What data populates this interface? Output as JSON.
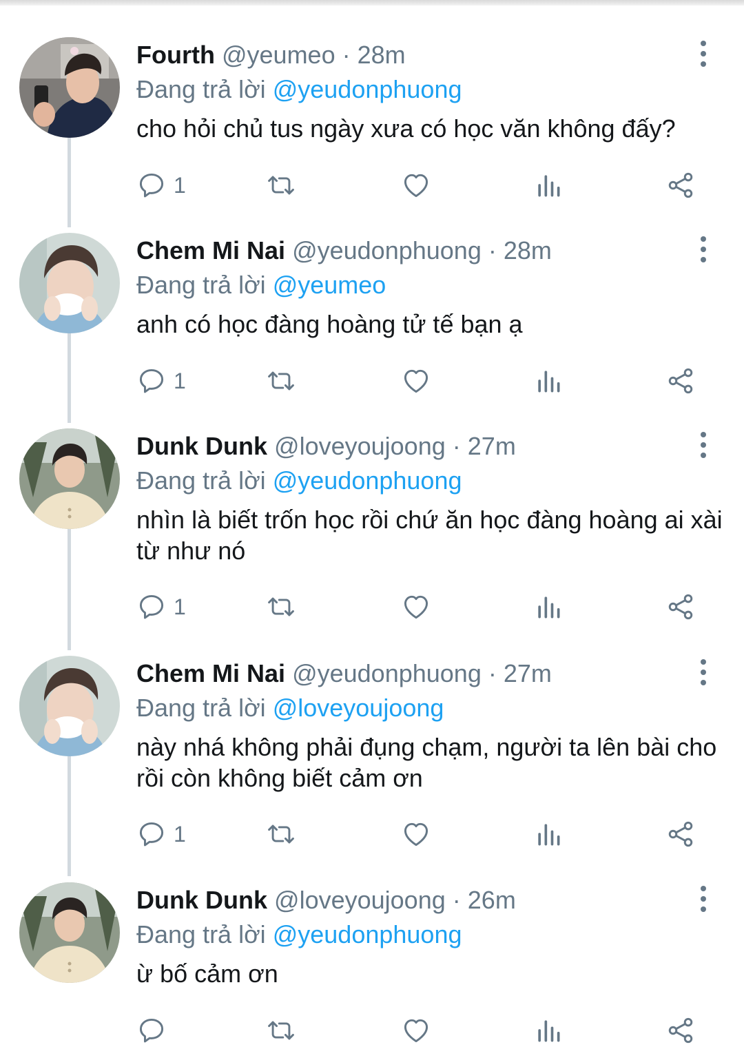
{
  "replying_label": "Đang trả lời",
  "separator": "·",
  "colors": {
    "accent": "#1da1f2",
    "muted": "#657786",
    "text": "#14171a",
    "thread_line": "#d2d9df"
  },
  "icons": {
    "reply": "reply-bubble-icon",
    "retweet": "retweet-icon",
    "like": "heart-icon",
    "analytics": "bar-chart-icon",
    "share": "share-icon",
    "more": "vertical-dots-icon"
  },
  "tweets": [
    {
      "name": "Fourth",
      "handle": "@yeumeo",
      "time": "28m",
      "replying_to": "@yeudonphuong",
      "text": "cho hỏi chủ tus ngày xưa có học văn không đấy?",
      "reply_count": "1"
    },
    {
      "name": "Chem Mi Nai",
      "handle": "@yeudonphuong",
      "time": "28m",
      "replying_to": "@yeumeo",
      "text": "anh có học đàng hoàng tử tế bạn ạ",
      "reply_count": "1"
    },
    {
      "name": "Dunk Dunk",
      "handle": "@loveyoujoong",
      "time": "27m",
      "replying_to": "@yeudonphuong",
      "text": "nhìn là biết trốn học rồi chứ ăn học đàng hoàng ai xài từ như nó",
      "reply_count": "1"
    },
    {
      "name": "Chem Mi Nai",
      "handle": "@yeudonphuong",
      "time": "27m",
      "replying_to": "@loveyoujoong",
      "text": "này nhá không phải đụng chạm, người ta lên bài cho rồi còn không biết cảm ơn",
      "reply_count": "1"
    },
    {
      "name": "Dunk Dunk",
      "handle": "@loveyoujoong",
      "time": "26m",
      "replying_to": "@yeudonphuong",
      "text": "ừ bố cảm ơn",
      "reply_count": ""
    }
  ]
}
